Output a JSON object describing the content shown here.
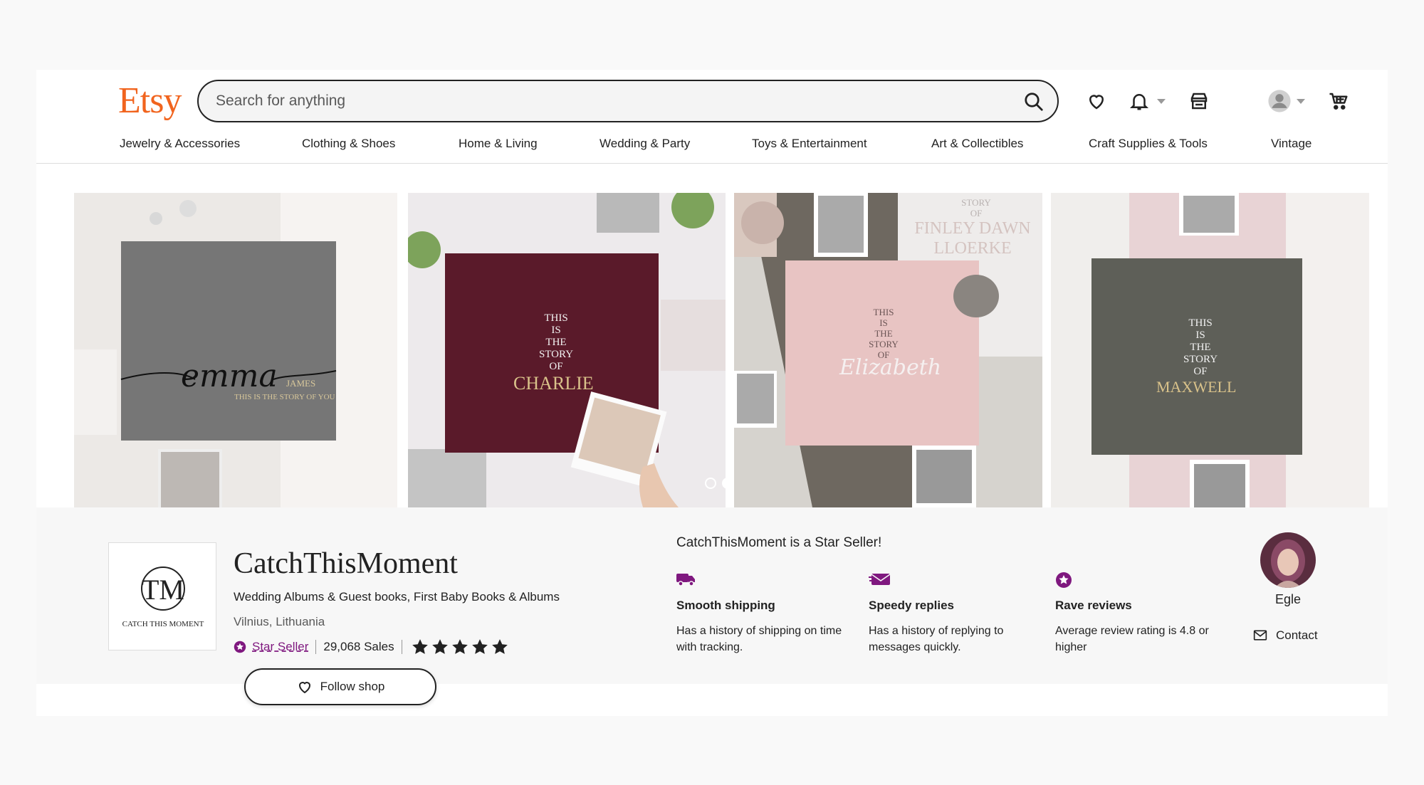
{
  "header": {
    "logo_text": "Etsy",
    "search_placeholder": "Search for anything"
  },
  "icons": {
    "favorites": "heart-icon",
    "notifications": "bell-icon",
    "shop_manager": "shop-icon",
    "account": "user-avatar-icon",
    "cart": "cart-icon"
  },
  "nav": [
    "Jewelry & Accessories",
    "Clothing & Shoes",
    "Home & Living",
    "Wedding & Party",
    "Toys & Entertainment",
    "Art & Collectibles",
    "Craft Supplies & Tools",
    "Vintage"
  ],
  "banner": {
    "panels": [
      {
        "lines": [
          "emma",
          "JAMES",
          "THIS IS THE STORY OF YOU"
        ],
        "cover": "#767676",
        "bg": "#e9e6e3"
      },
      {
        "lines": [
          "THIS",
          "IS",
          "THE",
          "STORY",
          "OF",
          "CHARLIE"
        ],
        "cover": "#5a1a2a",
        "bg": "#ece8ea"
      },
      {
        "lines": [
          "THIS",
          "IS",
          "THE",
          "STORY",
          "OF",
          "Elizabeth",
          "STORY",
          "OF",
          "FINLEY DAWN",
          "LLOERKE"
        ],
        "cover": "#e7c3c3",
        "bg": "#d8d5d0"
      },
      {
        "lines": [
          "THIS",
          "IS",
          "THE",
          "STORY",
          "OF",
          "MAXWELL"
        ],
        "cover": "#5e5f58",
        "bg": "#e9d4d6"
      }
    ]
  },
  "shop": {
    "name": "CatchThisMoment",
    "logo_line": "CATCH THIS MOMENT",
    "logo_monogram": "TM",
    "title": "Wedding Albums & Guest books, First Baby Books & Albums",
    "location": "Vilnius, Lithuania",
    "star_seller_label": "Star Seller",
    "sales": "29,068 Sales",
    "rating_stars": 5,
    "follow_label": "Follow shop"
  },
  "star_seller": {
    "heading": "CatchThisMoment is a Star Seller!",
    "features": [
      {
        "icon": "truck-icon",
        "title": "Smooth shipping",
        "desc": "Has a history of shipping on time with tracking."
      },
      {
        "icon": "envelope-icon",
        "title": "Speedy replies",
        "desc": "Has a history of replying to messages quickly."
      },
      {
        "icon": "star-badge-icon",
        "title": "Rave reviews",
        "desc": "Average review rating is 4.8 or higher"
      }
    ]
  },
  "owner": {
    "name": "Egle",
    "contact_label": "Contact"
  },
  "colors": {
    "brand": "#f1641e",
    "star_seller": "#7f187f",
    "text": "#222222"
  }
}
